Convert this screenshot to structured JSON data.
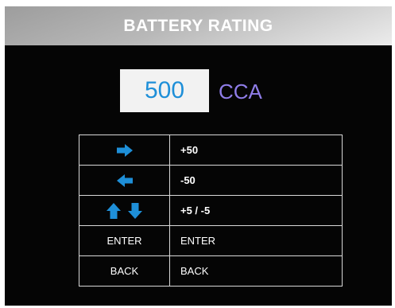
{
  "header": {
    "title": "BATTERY RATING"
  },
  "rating": {
    "value": "500",
    "unit": "CCA"
  },
  "keys": [
    {
      "icon": "arrow-right-icon",
      "description": "+50"
    },
    {
      "icon": "arrow-left-icon",
      "description": "-50"
    },
    {
      "icon": "arrow-up-down-icon",
      "description": "+5 / -5"
    },
    {
      "key": "ENTER",
      "description": "ENTER"
    },
    {
      "key": "BACK",
      "description": "BACK"
    }
  ],
  "colors": {
    "icon": "#1e8fd8",
    "value": "#1e8fd8",
    "unit": "#8f7de8",
    "background": "#050505"
  }
}
